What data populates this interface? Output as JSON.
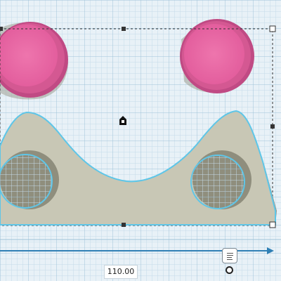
{
  "workplane": {
    "grid": true,
    "colors": {
      "background": "#e8f1f7",
      "grid_minor": "#c5dbe8",
      "grid_major": "#9fc3d8",
      "hole_pink": "#e96aa6",
      "hole_pink_dark": "#c04a84",
      "part_body": "#c8c7b5",
      "part_shadow": "#8f8e7d",
      "selection_outline": "#5ec6e8",
      "bounding_box": "#333333",
      "handle_fill": "#ffffff",
      "ruler_line": "#2f7fb5"
    }
  },
  "ruler": {
    "dimension_value": "110.00"
  },
  "icons": {
    "notes": "notes-icon",
    "rotate": "rotate-handle-icon",
    "center": "center-marker-icon"
  }
}
